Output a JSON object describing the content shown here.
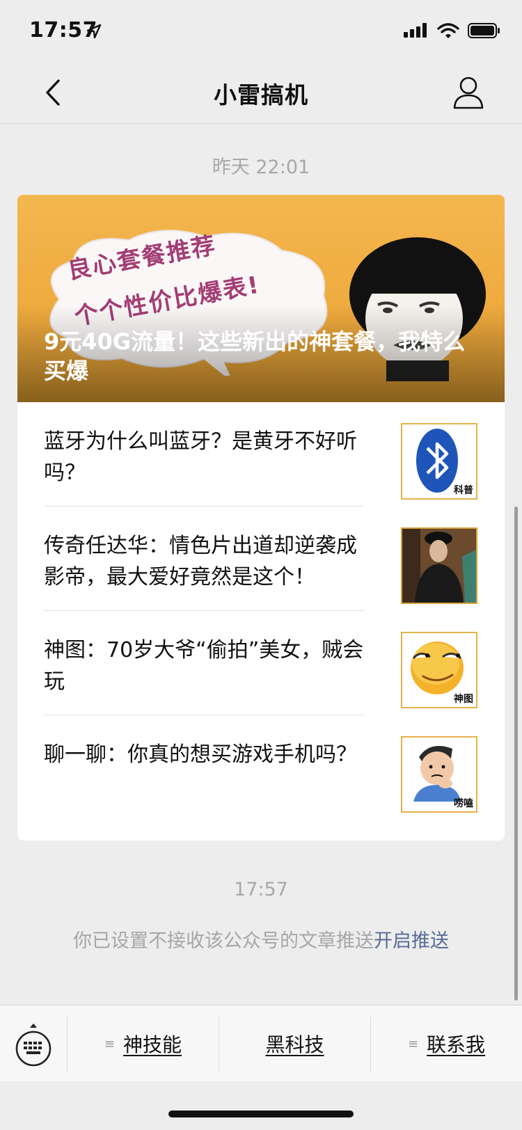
{
  "status_bar": {
    "time": "17:57",
    "icons": [
      "location-arrow-icon",
      "signal-icon",
      "wifi-icon",
      "battery-icon"
    ]
  },
  "nav": {
    "title": "小雷搞机",
    "back_icon": "chevron-left-icon",
    "profile_icon": "person-icon"
  },
  "message": {
    "timestamp": "昨天 22:01",
    "hero": {
      "title": "9元40G流量！这些新出的神套餐，我特么买爆",
      "image_caption_1": "良心套餐推荐",
      "image_caption_2": "个个性价比爆表!"
    },
    "articles": [
      {
        "title": "蓝牙为什么叫蓝牙？是黄牙不好听吗？",
        "thumb_tag": "科普",
        "thumb_icon": "bluetooth-icon"
      },
      {
        "title": "传奇任达华：情色片出道却逆袭成影帝，最大爱好竟然是这个！",
        "thumb_tag": "",
        "thumb_icon": "person-photo"
      },
      {
        "title": "神图：70岁大爷“偷拍”美女，贼会玩",
        "thumb_tag": "神图",
        "thumb_icon": "smirk-emoji-icon"
      },
      {
        "title": "聊一聊：你真的想买游戏手机吗？",
        "thumb_tag": "唠嗑",
        "thumb_icon": "thinking-man-icon"
      }
    ]
  },
  "notice": {
    "timestamp": "17:57",
    "text": "你已设置不接收该公众号的文章推送",
    "link": "开启推送"
  },
  "menu": {
    "items": [
      "神技能",
      "黑科技",
      "联系我"
    ],
    "submenu_glyph": "≡",
    "keyboard_icon": "keyboard-icon"
  },
  "colors": {
    "background": "#ededed",
    "link": "#576b95",
    "hero_orange": "#f0ae45"
  }
}
